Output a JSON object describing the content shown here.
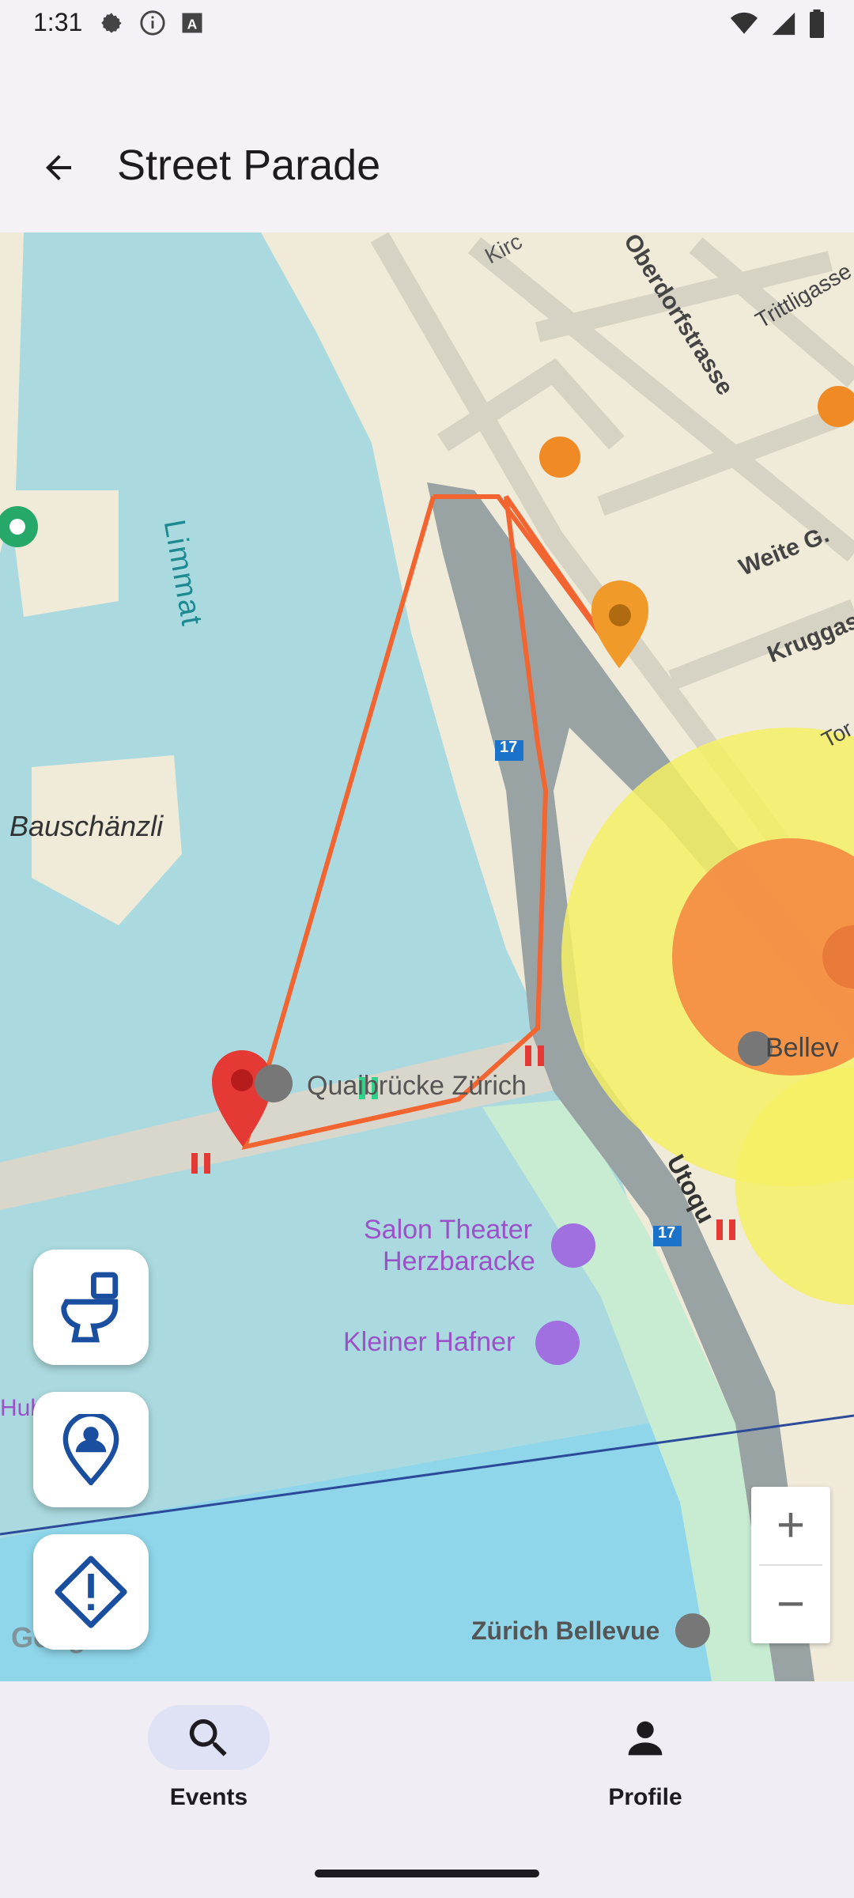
{
  "status_bar": {
    "time": "1:31",
    "left_icons": [
      "settings-icon",
      "info-icon",
      "font-icon"
    ],
    "right_icons": [
      "wifi-icon",
      "signal-icon",
      "battery-icon"
    ]
  },
  "app_bar": {
    "title": "Street Parade",
    "back_icon": "arrow-back-icon"
  },
  "map": {
    "labels": {
      "limmat": "Limmat",
      "bauschanzli": "Bauschänzli",
      "quaibrucke": "Quaibrücke Zürich",
      "salon_line1": "Salon Theater",
      "salon_line2": "Herzbaracke",
      "kleiner_hafner": "Kleiner Hafner",
      "zurich_bellevue": "Zürich Bellevue",
      "bellevue": "Bellev",
      "utoquai": "Utoqu",
      "oberdorfstrasse": "Oberdorfstrasse",
      "trittligasse": "Trittligasse",
      "weite_g": "Weite G.",
      "kruggasse": "Kruggass",
      "kirc": "Kirc",
      "tor": "Tor",
      "hub": "Hub",
      "tram_17": "17",
      "google": "Google"
    },
    "colors": {
      "water": "#aadadf",
      "land": "#f0ead9",
      "route": "#f26430",
      "heat_yellow": "#f5f064",
      "heat_orange": "#f58a42",
      "marker_red": "#e53935",
      "marker_orange": "#f09a2a"
    }
  },
  "fabs": [
    {
      "name": "toilet-button",
      "icon": "toilet-icon"
    },
    {
      "name": "location-person-button",
      "icon": "person-pin-icon"
    },
    {
      "name": "report-button",
      "icon": "warning-diamond-icon"
    }
  ],
  "zoom": {
    "plus": "+",
    "minus": "−"
  },
  "bottom_nav": {
    "items": [
      {
        "label": "Events",
        "icon": "search-icon",
        "active": true
      },
      {
        "label": "Profile",
        "icon": "person-icon",
        "active": false
      }
    ]
  }
}
